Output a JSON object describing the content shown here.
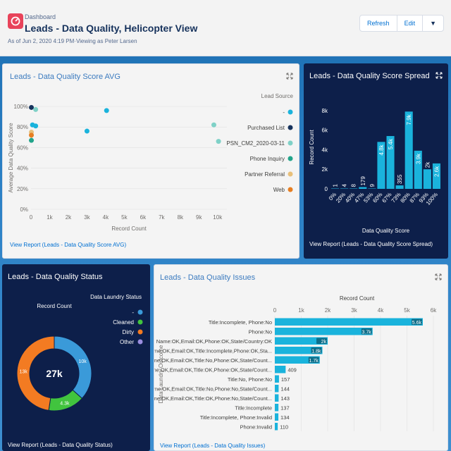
{
  "header": {
    "breadcrumb": "Dashboard",
    "title": "Leads - Data Quality, Helicopter View",
    "as_of": "As of Jun 2, 2020 4:19 PM·Viewing as Peter Larsen",
    "buttons": [
      "Refresh",
      "Edit",
      "▼"
    ]
  },
  "colors": {
    "accent": "#1ab3dc",
    "dark_card": "#0d1f4a",
    "brand": "#e8435a"
  },
  "cards": {
    "scatter": {
      "title": "Leads - Data Quality Score AVG",
      "report_link": "View Report (Leads - Data Quality Score AVG)",
      "legend_title": "Lead Source"
    },
    "spread": {
      "title": "Leads - Data Quality Score Spread",
      "report_link": "View Report (Leads - Data Quality Score Spread)"
    },
    "status": {
      "title": "Leads - Data Quality Status",
      "report_link": "View Report (Leads - Data Quality Status)",
      "legend_title": "Data Laundry Status",
      "center_label": "Record Count",
      "total": "27k"
    },
    "issues": {
      "title": "Leads - Data Quality Issues",
      "report_link": "View Report (Leads - Data Quality Issues)"
    }
  },
  "chart_data": [
    {
      "type": "scatter",
      "title": "Leads - Data Quality Score AVG",
      "xlabel": "Record Count",
      "ylabel": "Average Data Quality Score",
      "x_ticks": [
        "0",
        "1k",
        "2k",
        "3k",
        "4k",
        "5k",
        "6k",
        "7k",
        "8k",
        "9k",
        "10k"
      ],
      "y_ticks": [
        "0%",
        "20%",
        "40%",
        "60%",
        "80%",
        "100%"
      ],
      "xlim": [
        0,
        10500
      ],
      "ylim": [
        0,
        100
      ],
      "legend": "right",
      "series": [
        {
          "name": "-",
          "color": "#1ab3dc",
          "points": [
            [
              80,
              82
            ],
            [
              250,
              81
            ],
            [
              4050,
              96
            ],
            [
              3000,
              76
            ]
          ]
        },
        {
          "name": "Purchased List",
          "color": "#16325c",
          "points": [
            [
              20,
              99
            ]
          ]
        },
        {
          "name": "PSN_CM2_2020-03-11",
          "color": "#7fd1c7",
          "points": [
            [
              250,
              97
            ],
            [
              9800,
              82
            ],
            [
              10050,
              66
            ]
          ]
        },
        {
          "name": "Phone Inquiry",
          "color": "#22a48a",
          "points": [
            [
              20,
              67
            ]
          ]
        },
        {
          "name": "Partner Referral",
          "color": "#e8c07a",
          "points": [
            [
              20,
              75
            ]
          ]
        },
        {
          "name": "Web",
          "color": "#e67e22",
          "points": [
            [
              20,
              72
            ]
          ]
        }
      ]
    },
    {
      "type": "bar",
      "title": "Leads - Data Quality Score Spread",
      "xlabel": "Data Quality Score",
      "ylabel": "Record Count",
      "categories": [
        "0%",
        "20%",
        "40%",
        "47%",
        "53%",
        "60%",
        "67%",
        "73%",
        "80%",
        "87%",
        "93%",
        "100%"
      ],
      "values": [
        1,
        4,
        8,
        179,
        9,
        4800,
        5400,
        355,
        7900,
        3900,
        2000,
        2600
      ],
      "labels": [
        "1",
        "4",
        "8",
        "179",
        "9",
        "4.8k",
        "5.4k",
        "355",
        "7.9k",
        "3.9k",
        "2k",
        "2.6k"
      ],
      "y_ticks": [
        "0",
        "2k",
        "4k",
        "6k",
        "8k"
      ],
      "ylim": [
        0,
        8500
      ]
    },
    {
      "type": "pie",
      "title": "Leads - Data Quality Status",
      "legend_title": "Data Laundry Status",
      "slices": [
        {
          "name": "-",
          "value": 10000,
          "label": "10k",
          "color": "#3a9ad9"
        },
        {
          "name": "Cleaned",
          "value": 4300,
          "label": "4.3k",
          "color": "#41c43e"
        },
        {
          "name": "Dirty",
          "value": 13000,
          "label": "13k",
          "color": "#f37b22"
        },
        {
          "name": "Other",
          "value": 0,
          "label": "",
          "color": "#9b8ee0"
        }
      ],
      "total": "27k",
      "center_label": "Record Count"
    },
    {
      "type": "bar",
      "orientation": "horizontal",
      "title": "Leads - Data Quality Issues",
      "xlabel": "Record Count",
      "ylabel": "Data Laundry Outcome",
      "x_ticks": [
        "0",
        "1k",
        "2k",
        "3k",
        "4k",
        "5k",
        "6k"
      ],
      "xlim": [
        0,
        6000
      ],
      "categories": [
        "Title:Incomplete, Phone:No",
        "Phone:No",
        "Name:OK,Email:OK,Phone:OK,State/Country:OK",
        "Name:OK,Email:OK,Title:Incomplete,Phone:OK,Sta...",
        "Name:OK,Email:OK,Title:No,Phone:OK,State/Count...",
        "Name:OK,Email:OK,Title:OK,Phone:OK,State/Count...",
        "Title:No, Phone:No",
        "Name:OK,Email:OK,Title:No,Phone:No,State/Count...",
        "Name:OK,Email:OK,Title:OK,Phone:No,State/Count...",
        "Title:Incomplete",
        "Title:Incomplete, Phone:Invalid",
        "Phone:Invalid"
      ],
      "values": [
        5600,
        3700,
        2000,
        1800,
        1700,
        409,
        157,
        144,
        143,
        137,
        134,
        110
      ],
      "labels": [
        "5.6k",
        "3.7k",
        "2k",
        "1.8k",
        "1.7k",
        "409",
        "157",
        "144",
        "143",
        "137",
        "134",
        "110"
      ]
    }
  ]
}
